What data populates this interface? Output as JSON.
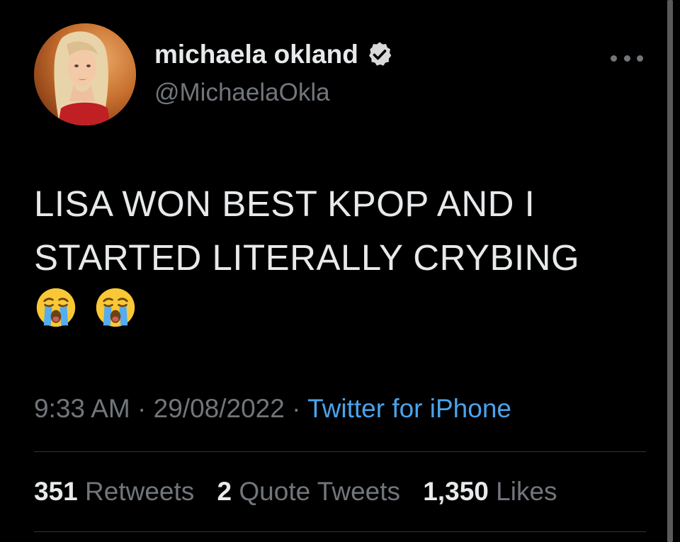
{
  "colors": {
    "background": "#000000",
    "text": "#e7e9ea",
    "muted": "#71767b",
    "link": "#4aa3ec",
    "divider": "#2f3336"
  },
  "author": {
    "display_name": "michaela okland",
    "handle": "@MichaelaOkla",
    "verified_icon": "verified-badge-icon",
    "avatar_icon": "profile-photo"
  },
  "more_menu_icon": "more-options-icon",
  "tweet": {
    "text_lines": [
      "LISA WON BEST KPOP AND I",
      "STARTED LITERALLY CRYBING"
    ],
    "emojis": [
      "loudly-crying-face-icon",
      "loudly-crying-face-icon"
    ]
  },
  "meta": {
    "time": "9:33 AM",
    "separator": "·",
    "date": "29/08/2022",
    "source": "Twitter for iPhone"
  },
  "stats": {
    "retweets_count": "351",
    "retweets_label": "Retweets",
    "quotes_count": "2",
    "quotes_label": "Quote Tweets",
    "likes_count": "1,350",
    "likes_label": "Likes"
  }
}
